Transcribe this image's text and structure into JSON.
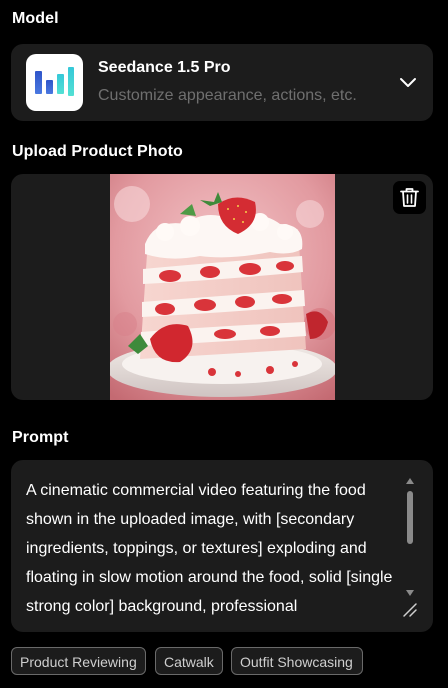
{
  "model": {
    "section_label": "Model",
    "name": "Seedance 1.5 Pro",
    "subtitle": "Customize appearance, actions, etc."
  },
  "upload": {
    "section_label": "Upload Product Photo",
    "image_subject": "strawberry cream layer cake slice"
  },
  "prompt": {
    "section_label": "Prompt",
    "value": "A cinematic commercial video featuring the food shown in the uploaded image, with [secondary ingredients, toppings, or textures] exploding and floating in slow motion around the food, solid [single strong color] background, professional"
  },
  "tags": [
    "Product Reviewing",
    "Catwalk",
    "Outfit Showcasing"
  ],
  "icons": {
    "model_logo": "bar-chart-logo-icon",
    "dropdown": "chevron-down-icon",
    "delete": "trash-icon",
    "resize": "resize-handle-icon"
  },
  "colors": {
    "background": "#000000",
    "card": "#1c1c1c",
    "text_primary": "#ffffff",
    "text_secondary": "#6f6f6f",
    "logo_blue": "#3a5fcf",
    "logo_cyan": "#3fd6d8"
  }
}
